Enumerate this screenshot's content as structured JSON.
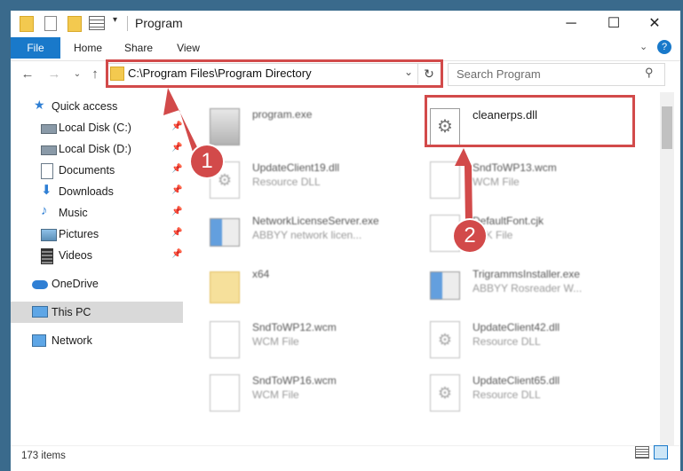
{
  "window": {
    "title": "Program",
    "minimize_glyph": "─",
    "maximize_glyph": "☐",
    "close_glyph": "✕"
  },
  "ribbon": {
    "tabs": [
      {
        "label": "File"
      },
      {
        "label": "Home"
      },
      {
        "label": "Share"
      },
      {
        "label": "View"
      }
    ]
  },
  "address": {
    "path": "C:\\Program Files\\Program Directory",
    "search_placeholder": "Search Program"
  },
  "sidebar": {
    "items": [
      {
        "label": "Quick access",
        "icon": "star-icon"
      },
      {
        "label": "Local Disk (C:)",
        "icon": "drive-icon",
        "pinned": true
      },
      {
        "label": "Local Disk (D:)",
        "icon": "drive-icon",
        "pinned": true
      },
      {
        "label": "Documents",
        "icon": "documents-icon",
        "pinned": true
      },
      {
        "label": "Downloads",
        "icon": "download-icon",
        "pinned": true
      },
      {
        "label": "Music",
        "icon": "music-icon",
        "pinned": true
      },
      {
        "label": "Pictures",
        "icon": "pictures-icon",
        "pinned": true
      },
      {
        "label": "Videos",
        "icon": "videos-icon",
        "pinned": true
      },
      {
        "label": "OneDrive",
        "icon": "cloud-icon"
      },
      {
        "label": "This PC",
        "icon": "computer-icon",
        "selected": true
      },
      {
        "label": "Network",
        "icon": "network-icon"
      }
    ]
  },
  "files": [
    {
      "name": "program.exe",
      "type": ""
    },
    {
      "name": "cleanerps.dll",
      "type": ""
    },
    {
      "name": "UpdateClient19.dll",
      "type": "Resource DLL"
    },
    {
      "name": "SndToWP13.wcm",
      "type": "WCM File"
    },
    {
      "name": "NetworkLicenseServer.exe",
      "type": "ABBYY network licen..."
    },
    {
      "name": "DefaultFont.cjk",
      "type": "CJK File"
    },
    {
      "name": "x64",
      "type": ""
    },
    {
      "name": "TrigrammsInstaller.exe",
      "type": "ABBYY Rosreader W..."
    },
    {
      "name": "SndToWP12.wcm",
      "type": "WCM File"
    },
    {
      "name": "UpdateClient42.dll",
      "type": "Resource DLL"
    },
    {
      "name": "SndToWP16.wcm",
      "type": "WCM File"
    },
    {
      "name": "UpdateClient65.dll",
      "type": "Resource DLL"
    }
  ],
  "status": {
    "item_count": "173 items"
  },
  "annotations": {
    "badge1": "1",
    "badge2": "2",
    "accent_color": "#d24a4a"
  }
}
